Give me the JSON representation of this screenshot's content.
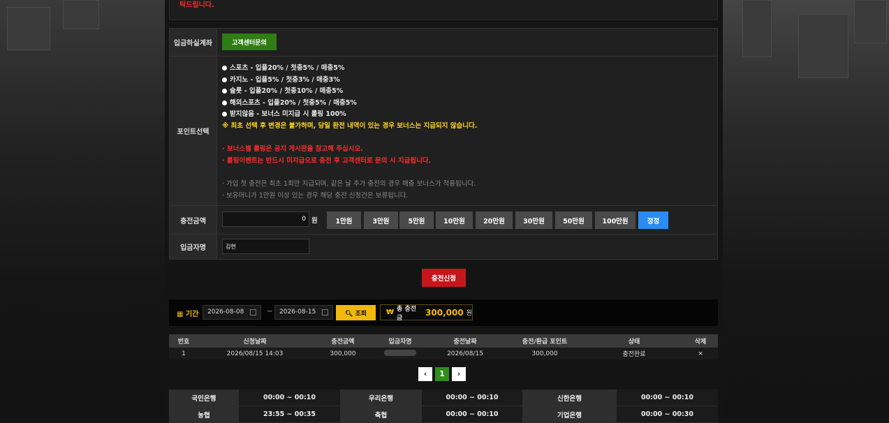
{
  "top_notice": "탁드립니다.",
  "deposit_account": {
    "label": "입금하실계좌",
    "button": "고객센터문의"
  },
  "point_select": {
    "label": "포인트선택",
    "options": [
      "스포츠 - 입플20% / 첫충5% / 매충5%",
      "카지노 - 입플5% / 첫충3% / 매충3%",
      "슬롯 - 입플20% / 첫충10% / 매충5%",
      "해외스포츠 - 입플20% / 첫충5% / 매충5%",
      "받지않음 - 보너스 미지급 시 롤링 100%"
    ],
    "notice_yellow": "※ 최초 선택 후 변경은 불가하며, 당일 환전 내역이 있는 경우 보너스는 지급되지 않습니다.",
    "notice_red_1": "· 보너스별 롤링은 공지 게시판을 참고해 주십시오.",
    "notice_red_2": "· 롤링이벤트는 반드시 미지급으로 충전 후 고객센터로 문의 시 지급됩니다.",
    "notice_gray_1": "· 가입 첫 충전은 최초 1회만 지급되며, 같은 날 추가 충전의 경우 매충 보너스가 적용됩니다.",
    "notice_gray_2": "· 보유머니가 1만원 이상 있는 경우 해당 충전 신청건은 보류됩니다."
  },
  "charge_amount": {
    "label": "충전금액",
    "value": "0",
    "unit": "원",
    "buttons": [
      "1만원",
      "3만원",
      "5만원",
      "10만원",
      "20만원",
      "30만원",
      "50만원",
      "100만원"
    ],
    "reset": "정정"
  },
  "depositor": {
    "label": "입금자명",
    "value": "김현"
  },
  "submit_label": "충전신청",
  "filter": {
    "period_label": "기간",
    "date_from": "2026-08-08",
    "date_to": "2026-08-15",
    "dash": "~",
    "search_label": "조회",
    "total_symbol": "₩",
    "total_label": "총 충전금",
    "total_value": "300,000",
    "total_unit": "원"
  },
  "table": {
    "headers": [
      "번호",
      "신청날짜",
      "충전금액",
      "입금자명",
      "충전날짜",
      "충전/환급 포인트",
      "상태",
      "삭제"
    ],
    "rows": [
      {
        "no": "1",
        "req_date": "2026/08/15 14:03",
        "amount": "300,000",
        "charge_date": "2026/08/15",
        "points": "300,000",
        "status": "충전완료",
        "delete": "×"
      }
    ]
  },
  "pagination": {
    "prev": "‹",
    "current": "1",
    "next": "›"
  },
  "banks": [
    [
      {
        "name": "국민은행",
        "time": "00:00 ~ 00:10"
      },
      {
        "name": "우리은행",
        "time": "00:00 ~ 00:10"
      },
      {
        "name": "신한은행",
        "time": "00:00 ~ 00:10"
      }
    ],
    [
      {
        "name": "농협",
        "time": "23:55 ~ 00:35"
      },
      {
        "name": "축협",
        "time": "00:00 ~ 00:10"
      },
      {
        "name": "기업은행",
        "time": "00:00 ~ 00:30"
      }
    ]
  ],
  "colors": {
    "accent_gold": "#f2b90c",
    "submit_red": "#c6161c",
    "green": "#2f7d14",
    "blue": "#2a8bf0"
  }
}
